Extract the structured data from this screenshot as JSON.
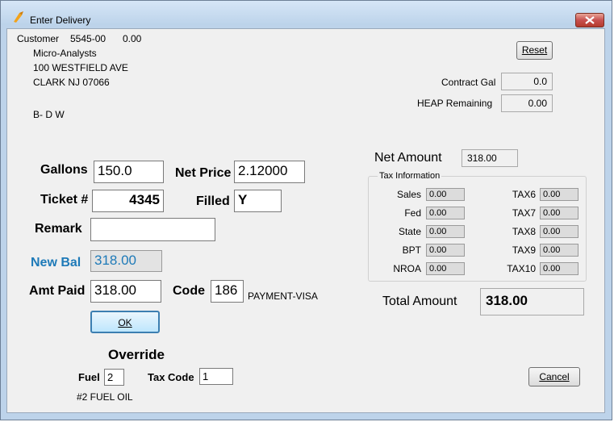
{
  "window": {
    "title": "Enter Delivery"
  },
  "customer": {
    "label": "Customer",
    "number": "5545-00",
    "balance": "0.00",
    "name": "Micro-Analysts",
    "street": "100 WESTFIELD AVE",
    "city": "CLARK NJ  07066",
    "code": "B- D W"
  },
  "reset_label": "Reset",
  "contract": {
    "label": "Contract Gal",
    "value": "0.0"
  },
  "heap": {
    "label": "HEAP Remaining",
    "value": "0.00"
  },
  "form": {
    "gallons_label": "Gallons",
    "gallons_value": "150.0",
    "net_price_label": "Net Price",
    "net_price_value": "2.12000",
    "ticket_label": "Ticket #",
    "ticket_value": "4345",
    "filled_label": "Filled",
    "filled_value": "Y",
    "remark_label": "Remark",
    "remark_value": "",
    "new_bal_label": "New Bal",
    "new_bal_value": "318.00",
    "amt_paid_label": "Amt Paid",
    "amt_paid_value": "318.00",
    "code_label": "Code",
    "code_value": "186",
    "code_desc": "PAYMENT-VISA"
  },
  "ok_label": "OK",
  "net_amount": {
    "label": "Net Amount",
    "value": "318.00"
  },
  "tax": {
    "group_label": "Tax Information",
    "left": [
      {
        "label": "Sales",
        "value": "0.00"
      },
      {
        "label": "Fed",
        "value": "0.00"
      },
      {
        "label": "State",
        "value": "0.00"
      },
      {
        "label": "BPT",
        "value": "0.00"
      },
      {
        "label": "NROA",
        "value": "0.00"
      }
    ],
    "right": [
      {
        "label": "TAX6",
        "value": "0.00"
      },
      {
        "label": "TAX7",
        "value": "0.00"
      },
      {
        "label": "TAX8",
        "value": "0.00"
      },
      {
        "label": "TAX9",
        "value": "0.00"
      },
      {
        "label": "TAX10",
        "value": "0.00"
      }
    ]
  },
  "total_amount": {
    "label": "Total Amount",
    "value": "318.00"
  },
  "override": {
    "title": "Override",
    "fuel_label": "Fuel",
    "fuel_value": "2",
    "tax_code_label": "Tax Code",
    "tax_code_value": "1",
    "fuel_desc": "#2 FUEL OIL"
  },
  "cancel_label": "Cancel",
  "colors": {
    "new_bal_label": "#1e7ab8",
    "title_bar": "#bcd3ea",
    "close_button": "#c75050"
  }
}
